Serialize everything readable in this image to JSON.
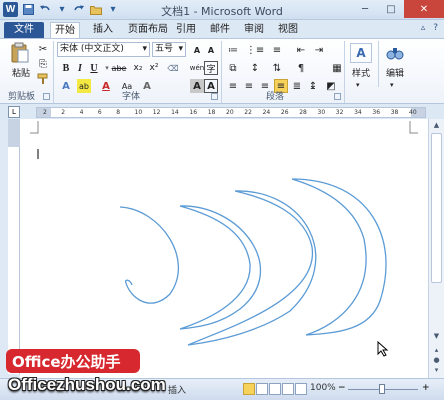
{
  "window": {
    "title": "文档1 - Microsoft Word",
    "controls": [
      "─",
      "□",
      "✕"
    ]
  },
  "quick_access": {
    "logo": "W",
    "save_icon": "save-icon",
    "undo_icon": "undo-icon",
    "redo_icon": "redo-icon"
  },
  "tabs": [
    "文件",
    "开始",
    "插入",
    "页面布局",
    "引用",
    "邮件",
    "审阅",
    "视图"
  ],
  "ribbon": {
    "paste_label": "粘贴",
    "clipboard_group": "剪贴板",
    "font_name": "宋体 (中文正文)",
    "font_size": "五号",
    "font_group": "字体",
    "paragraph_group": "段落",
    "styles_label": "样式",
    "editing_label": "编辑",
    "bold": "B",
    "italic": "I",
    "underline": "U",
    "strike": "abe",
    "subscript": "x₂",
    "superscript": "x²",
    "grow": "A",
    "shrink": "A",
    "aa": "Aa",
    "wen": "wén",
    "char_border": "A",
    "char_shade": "A",
    "text_effect": "A",
    "highlight": "ab",
    "font_color": "A",
    "circle_char": "字"
  },
  "ruler": {
    "corner": "L",
    "ticks": [
      "2",
      "2",
      "4",
      "6",
      "8",
      "10",
      "12",
      "14",
      "16",
      "18",
      "20",
      "22",
      "24",
      "26",
      "28",
      "30",
      "32",
      "34",
      "36",
      "38",
      "40"
    ]
  },
  "statusbar": {
    "insert_mode": "插入",
    "zoom": "100%",
    "minus": "−",
    "plus": "+"
  },
  "watermark": {
    "brand": "Office办公助手",
    "url": "Officezhushou.com"
  }
}
